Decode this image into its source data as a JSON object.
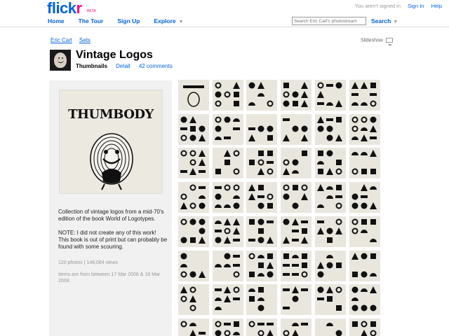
{
  "header": {
    "logo_flick": "flick",
    "logo_r": "r",
    "beta": "BETA",
    "not_signed_in": "You aren't signed in",
    "sign_in": "Sign In",
    "help": "Help"
  },
  "nav": {
    "items": [
      {
        "label": "Home"
      },
      {
        "label": "The Tour"
      },
      {
        "label": "Sign Up"
      },
      {
        "label": "Explore"
      }
    ],
    "search_placeholder": "Search Eric Carl's photostream",
    "search_button": "Search"
  },
  "breadcrumb": {
    "owner": "Eric Carl",
    "sets": "Sets"
  },
  "slideshow": "Slideshow",
  "set": {
    "title": "Vintage Logos",
    "tab_current": "Thumbnails",
    "tab_detail": "Detail",
    "comments": "42 comments"
  },
  "cover": {
    "title": "THUMBODY"
  },
  "description": {
    "p1": "Collection of vintage logos from a mid-70's edition of the book World of Logotypes.",
    "p2": "NOTE: I did not create any of this work! This book is out of print but can probably be found with some scouring."
  },
  "stats": {
    "counts": "120 photos | 148,084 views",
    "dates": "Items are from between 17 Mar 2008 & 18 Mar 2008."
  },
  "grid": {
    "rows": 8,
    "cols": 6
  }
}
